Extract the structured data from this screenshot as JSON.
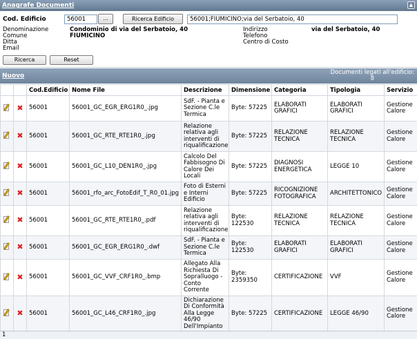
{
  "panel": {
    "title": "Anagrafe Documenti",
    "collapse_icon": "chevron-up-icon"
  },
  "filter": {
    "cod_label": "Cod. Edificio",
    "cod_value": "56001",
    "dots_label": "...",
    "ricerca_edificio_label": "Ricerca Edificio",
    "selected_value": "56001;FIUMICINO;via del Serbatoio, 40",
    "fields": {
      "denominazione_label": "Denominazione",
      "denominazione_value": "Condominio di via del Serbatoio, 40",
      "comune_label": "Comune",
      "comune_value": "FIUMICINO",
      "ditta_label": "Ditta",
      "email_label": "Email",
      "indirizzo_label": "Indirizzo",
      "indirizzo_value": "via del Serbatoio, 40",
      "telefono_label": "Telefono",
      "centro_label": "Centro di Costo"
    },
    "ricerca_label": "Ricerca",
    "reset_label": "Reset"
  },
  "toolbar": {
    "nuovo_label": "Nuovo",
    "docs_label": "Documenti legati all'edificio:",
    "docs_count": "8"
  },
  "table": {
    "headers": [
      "",
      "",
      "Cod.Edificio",
      "Nome File",
      "Descrizione",
      "Dimensione",
      "Categoria",
      "Tipologia",
      "Servizio"
    ],
    "rows": [
      {
        "cod": "56001",
        "file": "56001_GC_EGR_ERG1R0_.jpg",
        "desc": "SdF. - Pianta e Sezione C.le Termica",
        "dim": "Byte: 57225",
        "cat": "ELABORATI GRAFICI",
        "tip": "ELABORATI GRAFICI",
        "serv": "Gestione Calore"
      },
      {
        "cod": "56001",
        "file": "56001_GC_RTE_RTE1R0_.jpg",
        "desc": "Relazione relativa agli interventi di riqualificazione",
        "dim": "Byte: 57225",
        "cat": "RELAZIONE TECNICA",
        "tip": "RELAZIONE TECNICA",
        "serv": "Gestione Calore"
      },
      {
        "cod": "56001",
        "file": "56001_GC_L10_DEN1R0_.jpg",
        "desc": "Calcolo Del Fabbisogno Di Calore Dei Locali",
        "dim": "Byte: 57225",
        "cat": "DIAGNOSI ENERGETICA",
        "tip": "LEGGE 10",
        "serv": "Gestione Calore"
      },
      {
        "cod": "56001",
        "file": "56001_rfo_arc_FotoEdif_T_R0_01.jpg",
        "desc": "Foto di Esterni e Interni Edificio",
        "dim": "Byte: 57225",
        "cat": "RICOGNIZIONE FOTOGRAFICA",
        "tip": "ARCHITETTONICO",
        "serv": "Gestione Calore"
      },
      {
        "cod": "56001",
        "file": "56001_GC_RTE_RTE1R0_.pdf",
        "desc": "Relazione relativa agli interventi di riqualificazione",
        "dim": "Byte: 122530",
        "cat": "RELAZIONE TECNICA",
        "tip": "RELAZIONE TECNICA",
        "serv": "Gestione Calore"
      },
      {
        "cod": "56001",
        "file": "56001_GC_EGR_ERG1R0_.dwf",
        "desc": "SdF. - Pianta e Sezione C.le Termica",
        "dim": "Byte: 122530",
        "cat": "ELABORATI GRAFICI",
        "tip": "ELABORATI GRAFICI",
        "serv": "Gestione Calore"
      },
      {
        "cod": "56001",
        "file": "56001_GC_VVF_CRF1R0_.bmp",
        "desc": "Allegato Alla Richiesta Di Sopralluogo - Conto Corrente",
        "dim": "Byte: 2359350",
        "cat": "CERTIFICAZIONE",
        "tip": "VVF",
        "serv": "Gestione Calore"
      },
      {
        "cod": "56001",
        "file": "56001_GC_L46_CRF1R0_.jpg",
        "desc": "Dichiarazione Di Conformità Alla Legge 46/90 Dell'Impianto",
        "dim": "Byte: 57225",
        "cat": "CERTIFICAZIONE",
        "tip": "LEGGE 46/90",
        "serv": "Gestione Calore"
      }
    ]
  },
  "footer": {
    "page": "1"
  }
}
